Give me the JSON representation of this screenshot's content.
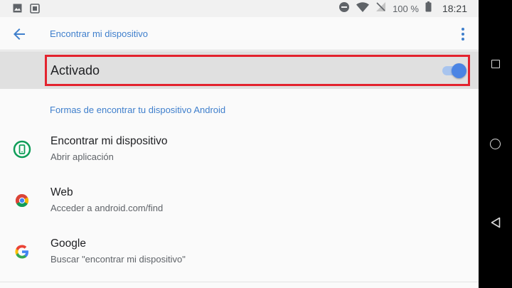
{
  "status_bar": {
    "left_icons": [
      "image-icon",
      "screenshot-icon"
    ],
    "right_icons": [
      "do-not-disturb-icon",
      "wifi-icon",
      "no-signal-icon"
    ],
    "battery": "100 %",
    "time": "18:21"
  },
  "app_bar": {
    "title": "Encontrar mi dispositivo",
    "back_icon": "arrow-back-icon",
    "menu_icon": "more-vert-icon"
  },
  "master_switch": {
    "label": "Activado",
    "checked": true
  },
  "section": {
    "header": "Formas de encontrar tu dispositivo Android"
  },
  "items": [
    {
      "title": "Encontrar mi dispositivo",
      "subtitle": "Abrir aplicación",
      "icon": "find-my-device-icon"
    },
    {
      "title": "Web",
      "subtitle": "Acceder a android.com/find",
      "icon": "chrome-icon"
    },
    {
      "title": "Google",
      "subtitle": "Buscar \"encontrar mi dispositivo\"",
      "icon": "google-icon"
    }
  ],
  "nav_bar": [
    "recents-button",
    "home-button",
    "back-button"
  ],
  "colors": {
    "accent": "#3f7fcc",
    "switch_on": "#4b84e4",
    "highlight": "#e3232e"
  }
}
